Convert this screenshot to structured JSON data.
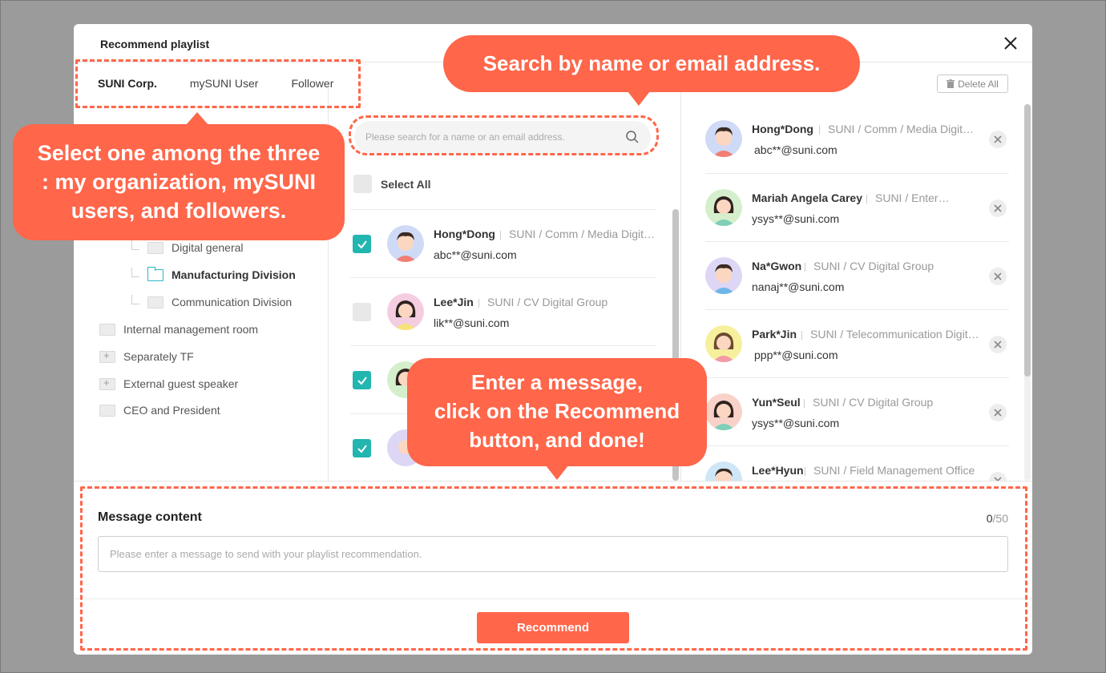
{
  "modal": {
    "title": "Recommend playlist"
  },
  "tabs": [
    {
      "label": "SUNI Corp.",
      "active": true
    },
    {
      "label": "mySUNI User",
      "active": false
    },
    {
      "label": "Follower",
      "active": false
    }
  ],
  "tree": [
    {
      "label": "Digital general",
      "level": 2,
      "icon": "folder-icon"
    },
    {
      "label": "Manufacturing Division",
      "level": 2,
      "icon": "folder-open-icon",
      "selected": true
    },
    {
      "label": "Communication Division",
      "level": 2,
      "icon": "folder-icon"
    },
    {
      "label": "Internal management room",
      "level": 1,
      "icon": "folder-icon"
    },
    {
      "label": "Separately TF",
      "level": 1,
      "icon": "folder-plus-icon"
    },
    {
      "label": "External guest speaker",
      "level": 1,
      "icon": "folder-plus-icon"
    },
    {
      "label": "CEO and President",
      "level": 1,
      "icon": "folder-icon"
    }
  ],
  "search": {
    "placeholder": "Please search for a name or an email address."
  },
  "select_all": {
    "label": "Select All"
  },
  "results": [
    {
      "name": "Hong*Dong",
      "org": "SUNI /  Comm / Media Digital Group",
      "email": "abc**@suni.com",
      "checked": true
    },
    {
      "name": "Lee*Jin",
      "org": "SUNI / CV Digital Group",
      "email": "lik**@suni.com",
      "checked": false
    },
    {
      "name": "",
      "org": "",
      "email": "",
      "checked": true
    },
    {
      "name": "",
      "org": "",
      "email": "",
      "checked": true
    }
  ],
  "selected_panel": {
    "delete_all_label": "Delete All",
    "users": [
      {
        "name": "Hong*Dong",
        "org": "SUNI / Comm / Media Digital Group",
        "email": "abc**@suni.com"
      },
      {
        "name": "Mariah Angela Carey",
        "org": "SUNI / Enterprise Group",
        "email": "ysys**@suni.com"
      },
      {
        "name": "Na*Gwon",
        "org": "SUNI / CV Digital Group",
        "email": "nanaj**@suni.com"
      },
      {
        "name": "Park*Jin",
        "org": "SUNI / Telecommunication Digital Group",
        "email": "ppp**@suni.com"
      },
      {
        "name": "Yun*Seul",
        "org": "SUNI / CV Digital Group",
        "email": "ysys**@suni.com"
      },
      {
        "name": "Lee*Hyun",
        "org": "SUNI / Field Management Office",
        "email": ""
      }
    ]
  },
  "message": {
    "label": "Message content",
    "count_current": "0",
    "count_max": "/50",
    "placeholder": "Please enter a message to send with your playlist recommendation."
  },
  "recommend_button": "Recommend",
  "callouts": {
    "tabs_line1": "Select one among the three",
    "tabs_line2": ": my organization, mySUNI",
    "tabs_line3": "users, and followers.",
    "search": "Search by name or email address.",
    "message_line1": "Enter a message,",
    "message_line2": "click on the Recommend",
    "message_line3": "button, and done!"
  },
  "colors": {
    "accent": "#ff664a",
    "checkbox": "#23b5b0",
    "overlay": "#9b9b9b"
  }
}
